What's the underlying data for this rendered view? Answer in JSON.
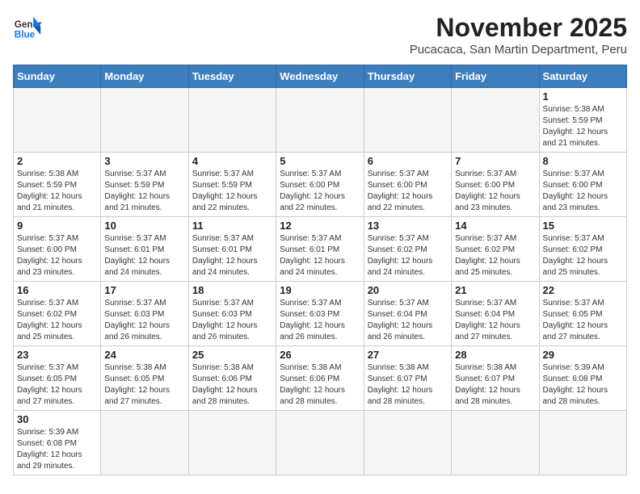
{
  "header": {
    "logo_line1": "General",
    "logo_line2": "Blue",
    "month": "November 2025",
    "location": "Pucacaca, San Martin Department, Peru"
  },
  "days_of_week": [
    "Sunday",
    "Monday",
    "Tuesday",
    "Wednesday",
    "Thursday",
    "Friday",
    "Saturday"
  ],
  "weeks": [
    [
      {
        "day": "",
        "info": ""
      },
      {
        "day": "",
        "info": ""
      },
      {
        "day": "",
        "info": ""
      },
      {
        "day": "",
        "info": ""
      },
      {
        "day": "",
        "info": ""
      },
      {
        "day": "",
        "info": ""
      },
      {
        "day": "1",
        "info": "Sunrise: 5:38 AM\nSunset: 5:59 PM\nDaylight: 12 hours and 21 minutes."
      }
    ],
    [
      {
        "day": "2",
        "info": "Sunrise: 5:38 AM\nSunset: 5:59 PM\nDaylight: 12 hours and 21 minutes."
      },
      {
        "day": "3",
        "info": "Sunrise: 5:37 AM\nSunset: 5:59 PM\nDaylight: 12 hours and 21 minutes."
      },
      {
        "day": "4",
        "info": "Sunrise: 5:37 AM\nSunset: 5:59 PM\nDaylight: 12 hours and 22 minutes."
      },
      {
        "day": "5",
        "info": "Sunrise: 5:37 AM\nSunset: 6:00 PM\nDaylight: 12 hours and 22 minutes."
      },
      {
        "day": "6",
        "info": "Sunrise: 5:37 AM\nSunset: 6:00 PM\nDaylight: 12 hours and 22 minutes."
      },
      {
        "day": "7",
        "info": "Sunrise: 5:37 AM\nSunset: 6:00 PM\nDaylight: 12 hours and 23 minutes."
      },
      {
        "day": "8",
        "info": "Sunrise: 5:37 AM\nSunset: 6:00 PM\nDaylight: 12 hours and 23 minutes."
      }
    ],
    [
      {
        "day": "9",
        "info": "Sunrise: 5:37 AM\nSunset: 6:00 PM\nDaylight: 12 hours and 23 minutes."
      },
      {
        "day": "10",
        "info": "Sunrise: 5:37 AM\nSunset: 6:01 PM\nDaylight: 12 hours and 24 minutes."
      },
      {
        "day": "11",
        "info": "Sunrise: 5:37 AM\nSunset: 6:01 PM\nDaylight: 12 hours and 24 minutes."
      },
      {
        "day": "12",
        "info": "Sunrise: 5:37 AM\nSunset: 6:01 PM\nDaylight: 12 hours and 24 minutes."
      },
      {
        "day": "13",
        "info": "Sunrise: 5:37 AM\nSunset: 6:02 PM\nDaylight: 12 hours and 24 minutes."
      },
      {
        "day": "14",
        "info": "Sunrise: 5:37 AM\nSunset: 6:02 PM\nDaylight: 12 hours and 25 minutes."
      },
      {
        "day": "15",
        "info": "Sunrise: 5:37 AM\nSunset: 6:02 PM\nDaylight: 12 hours and 25 minutes."
      }
    ],
    [
      {
        "day": "16",
        "info": "Sunrise: 5:37 AM\nSunset: 6:02 PM\nDaylight: 12 hours and 25 minutes."
      },
      {
        "day": "17",
        "info": "Sunrise: 5:37 AM\nSunset: 6:03 PM\nDaylight: 12 hours and 26 minutes."
      },
      {
        "day": "18",
        "info": "Sunrise: 5:37 AM\nSunset: 6:03 PM\nDaylight: 12 hours and 26 minutes."
      },
      {
        "day": "19",
        "info": "Sunrise: 5:37 AM\nSunset: 6:03 PM\nDaylight: 12 hours and 26 minutes."
      },
      {
        "day": "20",
        "info": "Sunrise: 5:37 AM\nSunset: 6:04 PM\nDaylight: 12 hours and 26 minutes."
      },
      {
        "day": "21",
        "info": "Sunrise: 5:37 AM\nSunset: 6:04 PM\nDaylight: 12 hours and 27 minutes."
      },
      {
        "day": "22",
        "info": "Sunrise: 5:37 AM\nSunset: 6:05 PM\nDaylight: 12 hours and 27 minutes."
      }
    ],
    [
      {
        "day": "23",
        "info": "Sunrise: 5:37 AM\nSunset: 6:05 PM\nDaylight: 12 hours and 27 minutes."
      },
      {
        "day": "24",
        "info": "Sunrise: 5:38 AM\nSunset: 6:05 PM\nDaylight: 12 hours and 27 minutes."
      },
      {
        "day": "25",
        "info": "Sunrise: 5:38 AM\nSunset: 6:06 PM\nDaylight: 12 hours and 28 minutes."
      },
      {
        "day": "26",
        "info": "Sunrise: 5:38 AM\nSunset: 6:06 PM\nDaylight: 12 hours and 28 minutes."
      },
      {
        "day": "27",
        "info": "Sunrise: 5:38 AM\nSunset: 6:07 PM\nDaylight: 12 hours and 28 minutes."
      },
      {
        "day": "28",
        "info": "Sunrise: 5:38 AM\nSunset: 6:07 PM\nDaylight: 12 hours and 28 minutes."
      },
      {
        "day": "29",
        "info": "Sunrise: 5:39 AM\nSunset: 6:08 PM\nDaylight: 12 hours and 28 minutes."
      }
    ],
    [
      {
        "day": "30",
        "info": "Sunrise: 5:39 AM\nSunset: 6:08 PM\nDaylight: 12 hours and 29 minutes."
      },
      {
        "day": "",
        "info": ""
      },
      {
        "day": "",
        "info": ""
      },
      {
        "day": "",
        "info": ""
      },
      {
        "day": "",
        "info": ""
      },
      {
        "day": "",
        "info": ""
      },
      {
        "day": "",
        "info": ""
      }
    ]
  ]
}
